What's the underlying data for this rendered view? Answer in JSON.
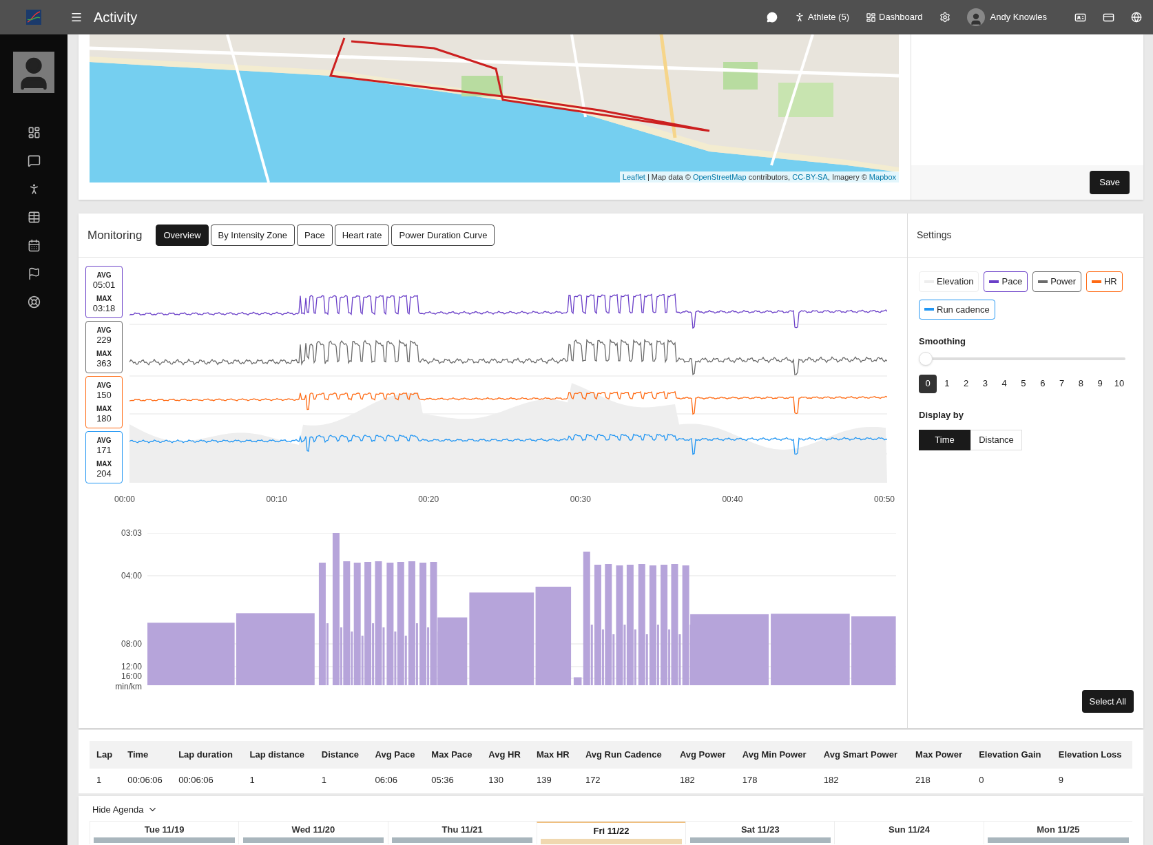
{
  "topbar": {
    "title": "Activity",
    "athlete": "Athlete (5)",
    "dashboard": "Dashboard",
    "user": "Andy Knowles"
  },
  "map_card": {
    "attribution": [
      {
        "kind": "link",
        "text": "Leaflet"
      },
      {
        "kind": "text",
        "text": " | Map data © "
      },
      {
        "kind": "link",
        "text": "OpenStreetMap"
      },
      {
        "kind": "text",
        "text": " contributors, "
      },
      {
        "kind": "link",
        "text": "CC-BY-SA"
      },
      {
        "kind": "text",
        "text": ", Imagery © "
      },
      {
        "kind": "link",
        "text": "Mapbox"
      }
    ],
    "save": "Save"
  },
  "monitoring": {
    "title": "Monitoring",
    "tabs": [
      {
        "label": "Overview",
        "selected": true
      },
      {
        "label": "By Intensity Zone",
        "selected": false
      },
      {
        "label": "Pace",
        "selected": false
      },
      {
        "label": "Heart rate",
        "selected": false
      },
      {
        "label": "Power Duration Curve",
        "selected": false
      }
    ],
    "stats": [
      {
        "color": "#6a3fc8",
        "avg_label": "AVG",
        "avg": "05:01",
        "max_label": "MAX",
        "max": "03:18"
      },
      {
        "color": "#6b6b6b",
        "avg_label": "AVG",
        "avg": "229",
        "max_label": "MAX",
        "max": "363"
      },
      {
        "color": "#ff6a13",
        "avg_label": "AVG",
        "avg": "150",
        "max_label": "MAX",
        "max": "180"
      },
      {
        "color": "#2196f3",
        "avg_label": "AVG",
        "avg": "171",
        "max_label": "MAX",
        "max": "204"
      }
    ],
    "x_axis": [
      "00:00",
      "00:10",
      "00:20",
      "00:30",
      "00:40",
      "00:50"
    ],
    "bar_y_axis": [
      "03:03",
      "04:00",
      "08:00",
      "12:00",
      "16:00"
    ],
    "bar_unit": "min/km"
  },
  "settings": {
    "title": "Settings",
    "series": [
      {
        "label": "Elevation",
        "color": "#eeeeee"
      },
      {
        "label": "Pace",
        "color": "#6a3fc8"
      },
      {
        "label": "Power",
        "color": "#6b6b6b"
      },
      {
        "label": "HR",
        "color": "#ff6a13"
      },
      {
        "label": "Run cadence",
        "color": "#2196f3"
      }
    ],
    "smoothing": {
      "label": "Smoothing",
      "level": 0,
      "ticks": [
        {
          "label": "0",
          "selected": true
        },
        {
          "label": "1",
          "selected": false
        },
        {
          "label": "2",
          "selected": false
        },
        {
          "label": "3",
          "selected": false
        },
        {
          "label": "4",
          "selected": false
        },
        {
          "label": "5",
          "selected": false
        },
        {
          "label": "6",
          "selected": false
        },
        {
          "label": "7",
          "selected": false
        },
        {
          "label": "8",
          "selected": false
        },
        {
          "label": "9",
          "selected": false
        },
        {
          "label": "10",
          "selected": false
        }
      ]
    },
    "display_by": {
      "label": "Display by",
      "options": [
        {
          "label": "Time",
          "selected": true
        },
        {
          "label": "Distance",
          "selected": false
        }
      ]
    },
    "select_all": "Select All"
  },
  "laps": {
    "columns": [
      "Lap",
      "Time",
      "Lap duration",
      "Lap distance",
      "Distance",
      "Avg Pace",
      "Max Pace",
      "Avg HR",
      "Max HR",
      "Avg Run Cadence",
      "Avg Power",
      "Avg Min Power",
      "Avg Smart Power",
      "Max Power",
      "Elevation Gain",
      "Elevation Loss"
    ],
    "rows": [
      [
        "1",
        "00:06:06",
        "00:06:06",
        "1",
        "1",
        "06:06",
        "05:36",
        "130",
        "139",
        "172",
        "182",
        "178",
        "182",
        "218",
        "0",
        "9"
      ]
    ]
  },
  "agenda": {
    "toggle": "Hide Agenda",
    "days": [
      {
        "label": "Tue 11/19",
        "today": false,
        "event": true
      },
      {
        "label": "Wed 11/20",
        "today": false,
        "event": true
      },
      {
        "label": "Thu 11/21",
        "today": false,
        "event": true
      },
      {
        "label": "Fri 11/22",
        "today": true,
        "event": true
      },
      {
        "label": "Sat 11/23",
        "today": false,
        "event": true
      },
      {
        "label": "Sun 11/24",
        "today": false,
        "event": false
      },
      {
        "label": "Mon 11/25",
        "today": false,
        "event": true
      }
    ]
  }
}
